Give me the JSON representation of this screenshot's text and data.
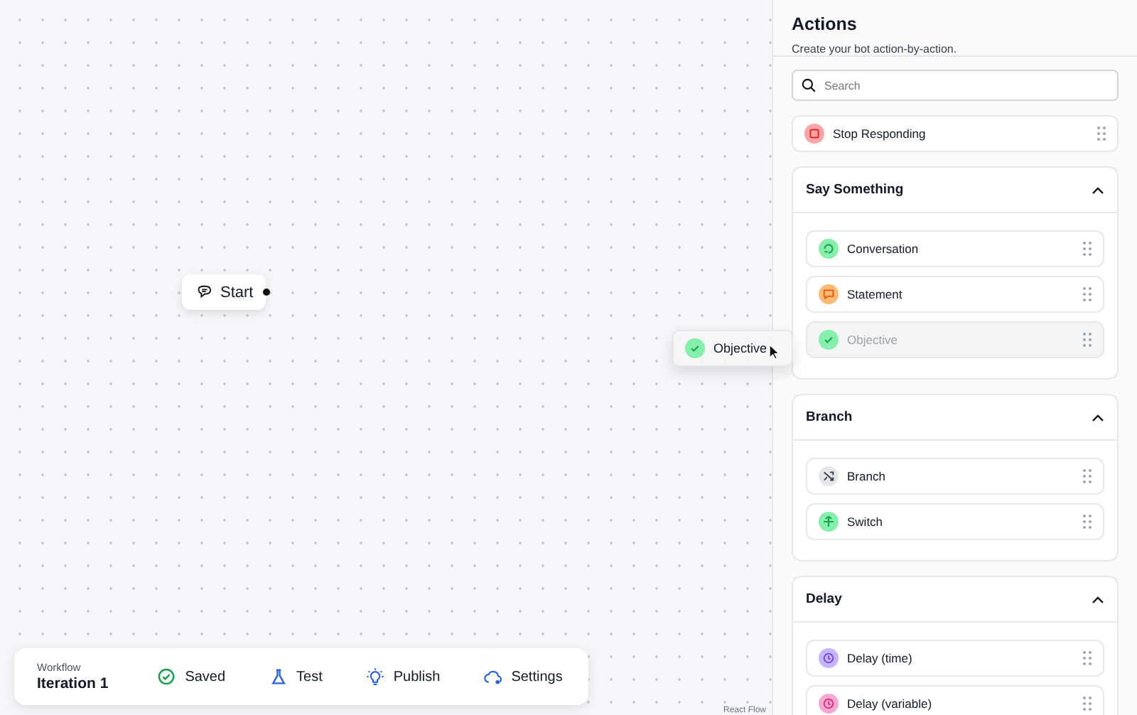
{
  "canvas": {
    "start_node": {
      "label": "Start"
    },
    "dragged_item": {
      "label": "Objective",
      "kind": "objective",
      "color": "#86efac"
    },
    "attribution": "React Flow"
  },
  "toolbar": {
    "workflow_label": "Workflow",
    "workflow_name": "Iteration 1",
    "actions": [
      {
        "label": "Saved",
        "kind": "saved"
      },
      {
        "label": "Test",
        "kind": "test"
      },
      {
        "label": "Publish",
        "kind": "publish"
      },
      {
        "label": "Settings",
        "kind": "settings"
      }
    ]
  },
  "panel": {
    "title": "Actions",
    "subtitle": "Create your bot action-by-action.",
    "search": {
      "placeholder": "Search"
    },
    "loose_items": [
      {
        "label": "Stop Responding",
        "kind": "stop",
        "color": "#fca5a5",
        "dragging": false
      }
    ],
    "sections": [
      {
        "title": "Say Something",
        "expanded": true,
        "items": [
          {
            "label": "Conversation",
            "kind": "conversation",
            "color": "#86efac",
            "dragging": false
          },
          {
            "label": "Statement",
            "kind": "statement",
            "color": "#fdba74",
            "dragging": false
          },
          {
            "label": "Objective",
            "kind": "objective",
            "color": "#86efac",
            "dragging": true
          }
        ]
      },
      {
        "title": "Branch",
        "expanded": true,
        "items": [
          {
            "label": "Branch",
            "kind": "branch",
            "color": "#e5e7eb",
            "dragging": false
          },
          {
            "label": "Switch",
            "kind": "switch",
            "color": "#86efac",
            "dragging": false
          }
        ]
      },
      {
        "title": "Delay",
        "expanded": true,
        "items": [
          {
            "label": "Delay (time)",
            "kind": "delay-time",
            "color": "#c4b5fd",
            "dragging": false
          },
          {
            "label": "Delay (variable)",
            "kind": "delay-variable",
            "color": "#f9a8d4",
            "dragging": false
          }
        ]
      }
    ]
  }
}
